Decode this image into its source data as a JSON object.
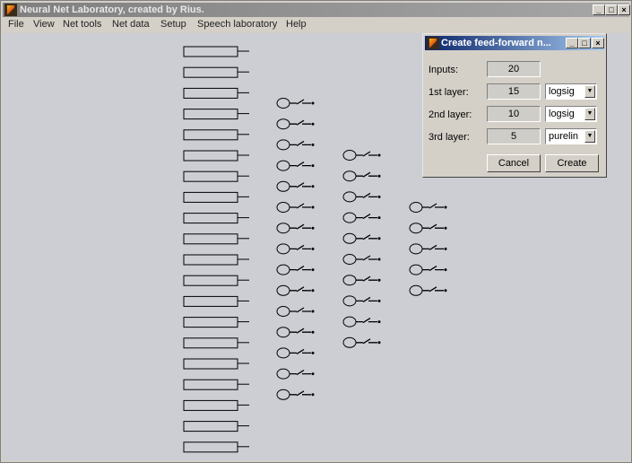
{
  "window": {
    "title": "Neural Net Laboratory, created by Rius.",
    "controls": {
      "minimize": "_",
      "maximize": "□",
      "close": "×"
    }
  },
  "menu": [
    "File",
    "View",
    "Net tools",
    "Net data",
    "Setup",
    "Speech laboratory",
    "Help"
  ],
  "network": {
    "layer_neuron_counts": [
      20,
      15,
      10,
      5
    ]
  },
  "dialog": {
    "title": "Create feed-forward n...",
    "controls": {
      "minimize": "_",
      "maximize": "□",
      "close": "×"
    },
    "inputs_label": "Inputs:",
    "inputs_value": "20",
    "layers": [
      {
        "label": "1st layer:",
        "neurons": "15",
        "transfer": "logsig"
      },
      {
        "label": "2nd layer:",
        "neurons": "10",
        "transfer": "logsig"
      },
      {
        "label": "3rd layer:",
        "neurons": "5",
        "transfer": "purelin"
      }
    ],
    "cancel_label": "Cancel",
    "create_label": "Create"
  },
  "colors": {
    "canvas": "#ccced4",
    "active_title": "#0a246a",
    "inactive_title": "#808080"
  }
}
